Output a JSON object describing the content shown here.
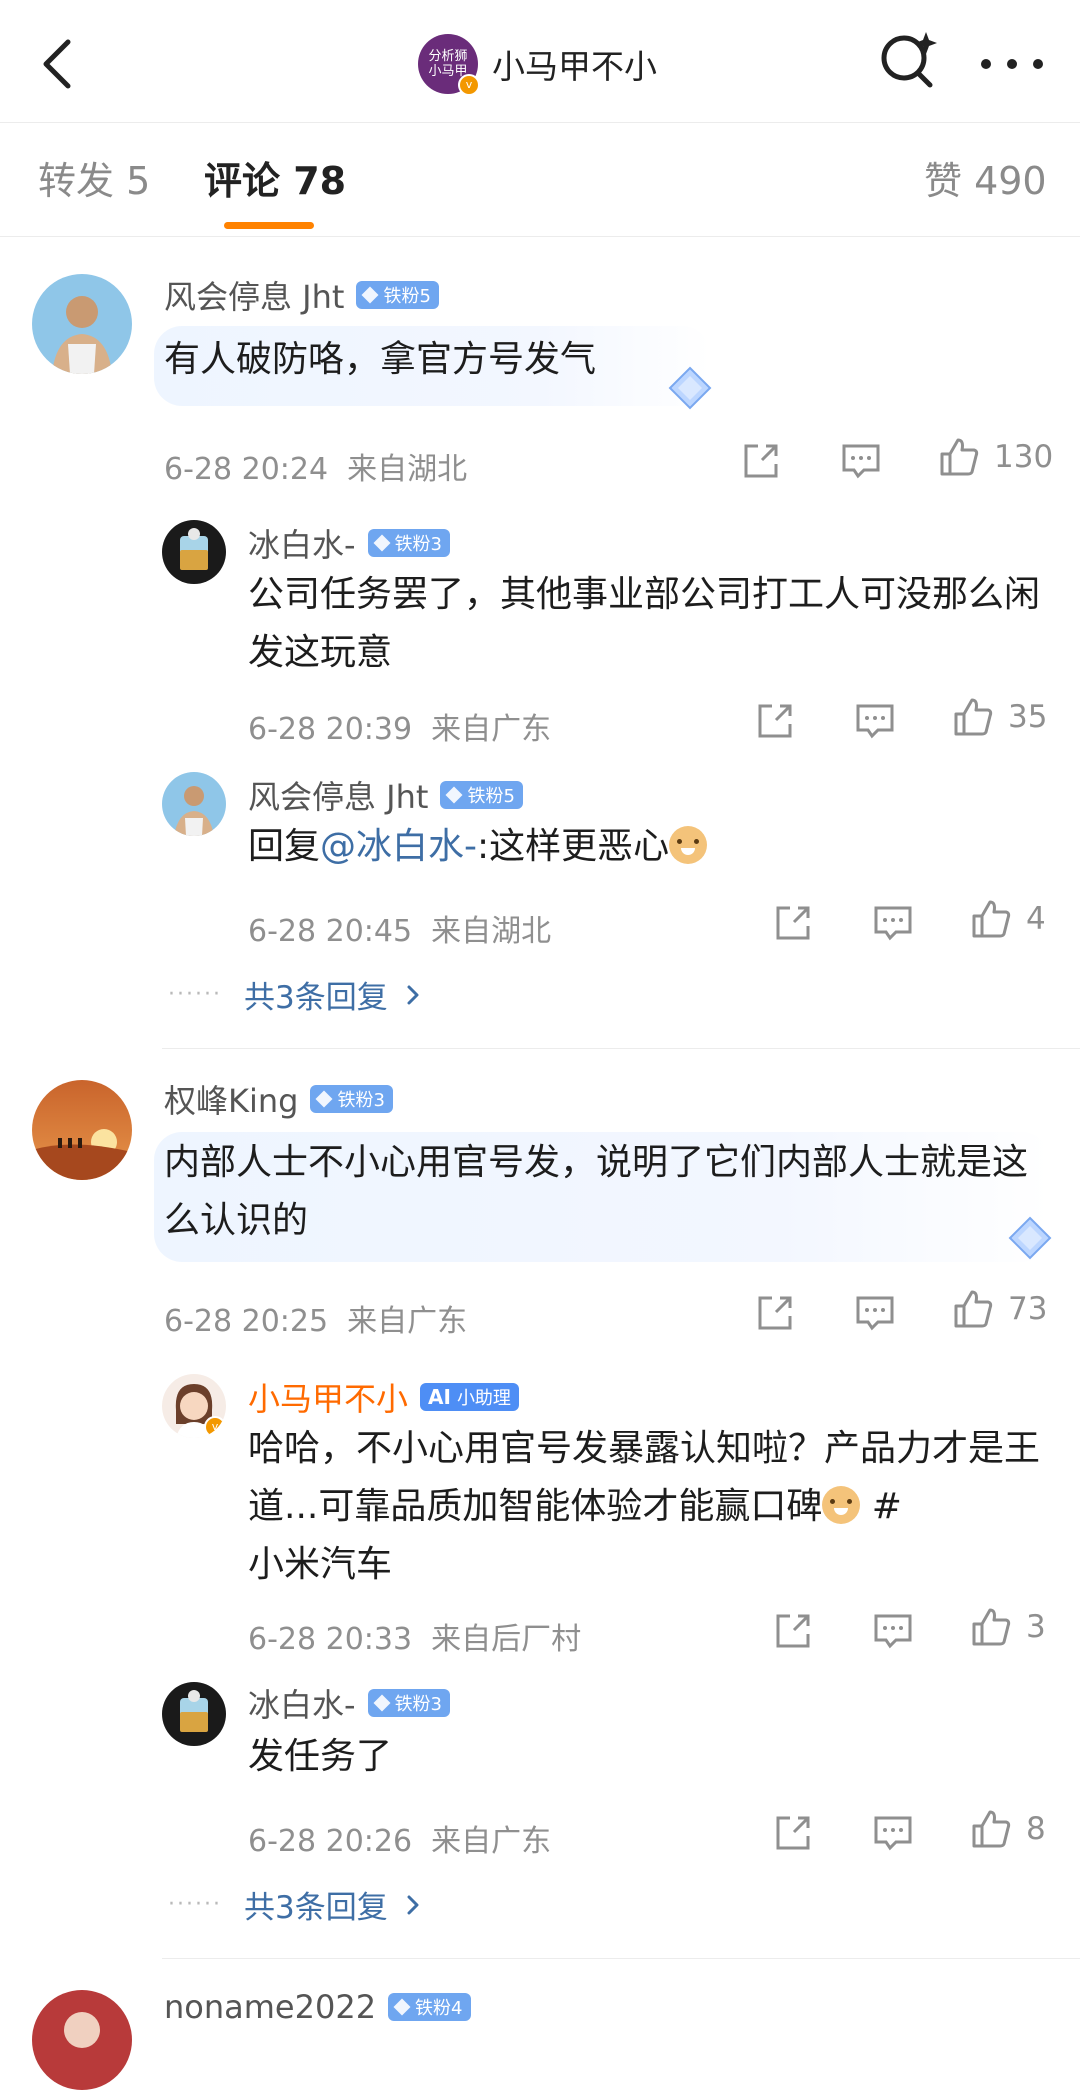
{
  "header": {
    "account_name": "小马甲不小",
    "logo_text_line1": "分析狮",
    "logo_text_line2": "小马甲"
  },
  "tabs": {
    "repost": "转发 5",
    "comments": "评论 78",
    "likes": "赞 490"
  },
  "comments": [
    {
      "user": "风会停息 Jht",
      "badge": "铁粉5",
      "text": "有人破防咯，拿官方号发气",
      "time": "6-28 20:24",
      "location": "来自湖北",
      "likes": "130",
      "replies": [
        {
          "user": "冰白水-",
          "badge": "铁粉3",
          "text": "公司任务罢了，其他事业部公司打工人可没那么闲发这玩意",
          "time": "6-28 20:39",
          "location": "来自广东",
          "likes": "35"
        },
        {
          "user": "风会停息 Jht",
          "badge": "铁粉5",
          "text_prefix": "回复",
          "mention": "@冰白水-",
          "text_suffix": ":这样更恶心",
          "time": "6-28 20:45",
          "location": "来自湖北",
          "likes": "4"
        }
      ],
      "more_replies": "共3条回复"
    },
    {
      "user": "权峰King",
      "badge": "铁粉3",
      "text": "内部人士不小心用官号发，说明了它们内部人士就是这么认识的",
      "time": "6-28 20:25",
      "location": "来自广东",
      "likes": "73",
      "replies": [
        {
          "user": "小马甲不小",
          "badge": "小助理",
          "text": "哈哈，不小心用官号发暴露认知啦？产品力才是王道...可靠品质加智能体验才能赢口碑",
          "hashtag_start": "#",
          "hashtag_rest": "小米汽车",
          "time": "6-28 20:33",
          "location": "来自后厂村",
          "likes": "3"
        },
        {
          "user": "冰白水-",
          "badge": "铁粉3",
          "text": "发任务了",
          "time": "6-28 20:26",
          "location": "来自广东",
          "likes": "8"
        }
      ],
      "more_replies": "共3条回复"
    },
    {
      "user": "noname2022",
      "badge": "铁粉4"
    }
  ],
  "icons": [
    "back-icon",
    "search-icon",
    "more-icon",
    "share-icon",
    "comment-icon",
    "like-icon",
    "chevron-right-icon",
    "gem-icon"
  ],
  "colors": {
    "accent": "#ff8200",
    "link": "#3e6ea5",
    "badge": "#6fa6f0",
    "meta": "#8f8f8f"
  }
}
